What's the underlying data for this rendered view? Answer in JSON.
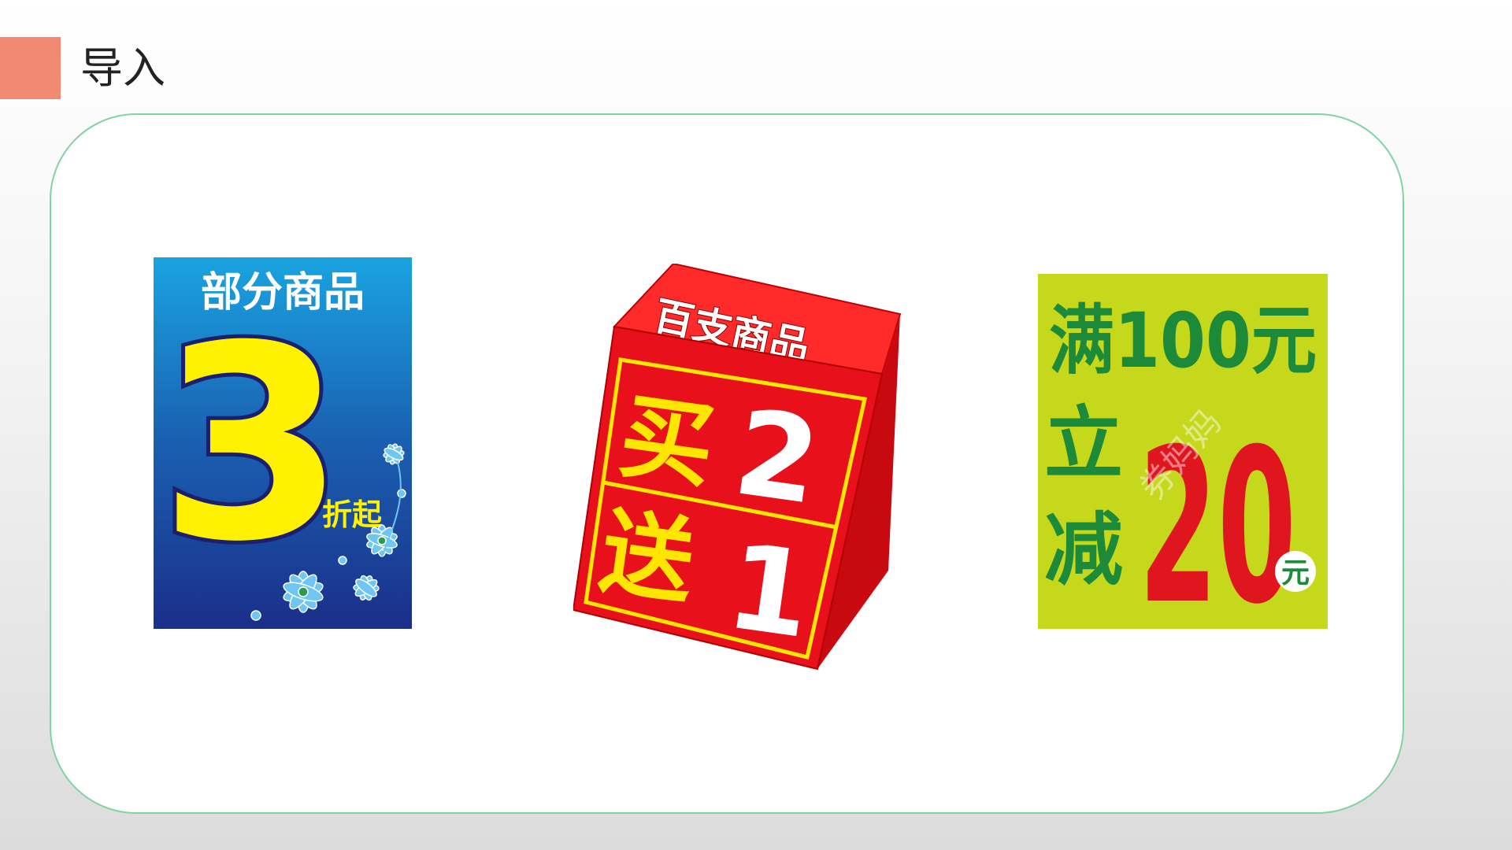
{
  "slide": {
    "title": "导入"
  },
  "signs": {
    "discount": {
      "headline": "部分商品",
      "number": "3",
      "suffix": "折起"
    },
    "cube": {
      "top": "百支商品",
      "buy_char": "买",
      "buy_num": "2",
      "give_char": "送",
      "give_num": "1"
    },
    "reduction": {
      "line1": "满100元",
      "line2_char": "立",
      "line3_char": "减",
      "amount": "20",
      "unit": "元",
      "watermark": "券妈妈"
    }
  },
  "colors": {
    "accent": "#f08a73",
    "panel_border": "#7fd3a4",
    "discount_bg": "#1f6fb8",
    "discount_yellow": "#fff200",
    "cube_red": "#e8101a",
    "cube_yellow": "#ffe600",
    "reduction_bg": "#c6d81c",
    "reduction_green": "#1d8a3a",
    "reduction_red": "#e0161f"
  }
}
